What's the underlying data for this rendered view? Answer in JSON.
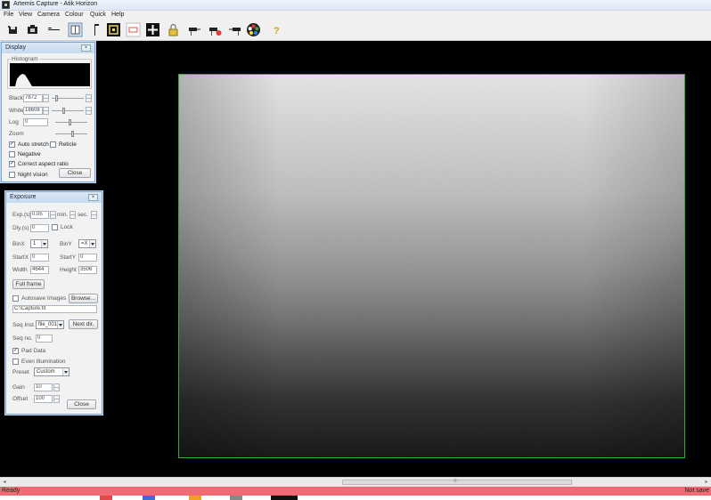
{
  "window": {
    "title": "Artemis Capture - Atik Horizon"
  },
  "menu": [
    "File",
    "View",
    "Camera",
    "Colour",
    "Quick",
    "Help"
  ],
  "toolbar": [
    {
      "name": "save-icon"
    },
    {
      "name": "camera-icon"
    },
    {
      "name": "line-profile-icon"
    },
    {
      "name": "grid-icon"
    },
    {
      "name": "flag-icon"
    },
    {
      "name": "focus-frame-icon"
    },
    {
      "name": "subframe-icon"
    },
    {
      "name": "crosshair-icon"
    },
    {
      "name": "lock-icon"
    },
    {
      "name": "mount-left-icon"
    },
    {
      "name": "mount-record-icon"
    },
    {
      "name": "mount-right-icon"
    },
    {
      "name": "colour-wheel-icon"
    },
    {
      "name": "help-icon"
    }
  ],
  "display_panel": {
    "title": "Display",
    "histogram_label": "Histogram",
    "black_label": "Black",
    "black_value": "7872",
    "white_label": "White",
    "white_value": "18608",
    "log_label": "Log",
    "log_value": "0",
    "zoom_label": "Zoom",
    "auto_stretch": "Auto stretch",
    "reticle": "Reticle",
    "negative": "Negative",
    "correct_aspect": "Correct aspect ratio",
    "night_vision": "Night vision",
    "close": "Close",
    "checks": {
      "auto_stretch": true,
      "reticle": false,
      "negative": false,
      "correct_aspect": true,
      "night_vision": false
    },
    "levels": {
      "black_slider": 0.12,
      "white_slider": 0.35,
      "log_slider": 0.45,
      "zoom_slider": 0.55
    }
  },
  "exposure_panel": {
    "title": "Exposure",
    "exp_label": "Exp.(s)",
    "exp_value": "0.05",
    "min_label": "min.",
    "sec_label": "sec.",
    "dly_label": "Dly.(s)",
    "dly_value": "0",
    "lock_label": "Lock",
    "binx_label": "BinX",
    "binx_value": "1",
    "biny_label": "BinY",
    "biny_value": "=X",
    "startx_label": "StartX",
    "startx_value": "0",
    "starty_label": "StartY",
    "starty_value": "0",
    "width_label": "Width",
    "width_value": "4644",
    "height_label": "Height",
    "height_value": "3506",
    "full_frame": "Full frame",
    "autosave_label": "Autosave Images",
    "browse": "Browse...",
    "path": "C:\\Capture.fit",
    "seq_inst_label": "Seq Inst.",
    "seq_inst_value": "file_001",
    "next_dir": "Next dir.",
    "seq_no_label": "Seq no.",
    "seq_no_value": "0",
    "pad_data": "Pad Data",
    "even_illum": "Even Illumination",
    "preset_label": "Preset",
    "preset_value": "Custom",
    "gain_label": "Gain",
    "gain_value": "10",
    "offset_label": "Offset",
    "offset_value": "100",
    "close": "Close",
    "checks": {
      "lock": false,
      "autosave": false,
      "pad_data": true,
      "even_illum": false
    }
  },
  "status": {
    "left": "Ready",
    "right": "Not save"
  },
  "colors": {
    "frame_border": "#2fae2f",
    "status_bg": "#f26a73",
    "accent": "#7aa6d2"
  }
}
